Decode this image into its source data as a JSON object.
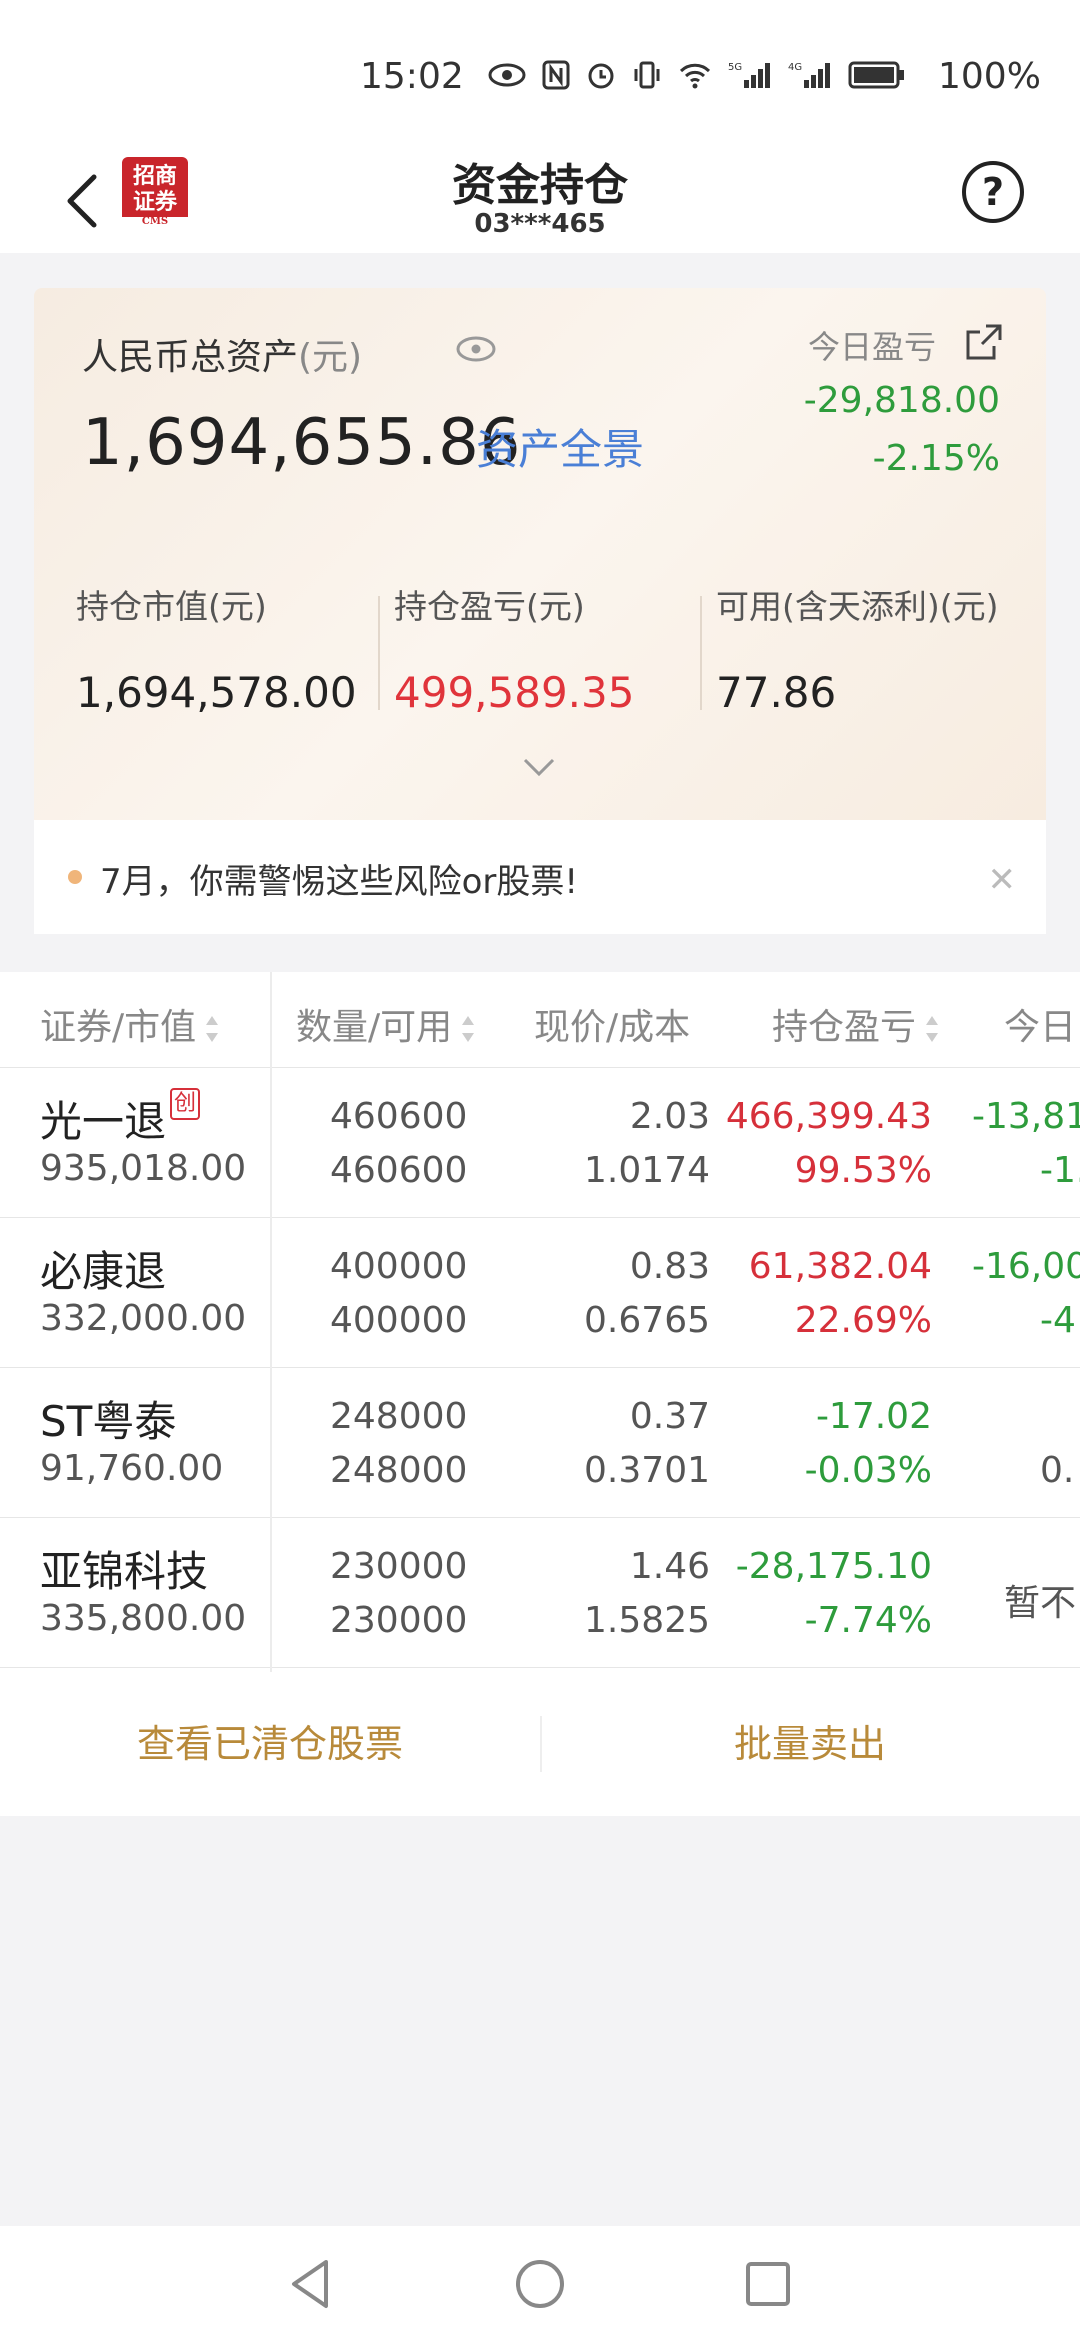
{
  "status_bar": {
    "time": "15:02",
    "battery": "100%",
    "icons": [
      "eye-icon",
      "nfc-icon",
      "alarm-icon",
      "vibrate-icon",
      "wifi-icon",
      "5g-signal-icon",
      "4g-signal-icon",
      "battery-icon"
    ]
  },
  "header": {
    "title": "资金持仓",
    "account": "03***465",
    "logo_text": "招商证券",
    "logo_sub": "CMS"
  },
  "assets": {
    "total_label": "人民币总资产",
    "total_unit": "(元)",
    "total_value": "1,694,655.86",
    "panorama_link": "资产全景",
    "today_label": "今日盈亏",
    "today_value": "-29,818.00",
    "today_pct": "-2.15%",
    "metrics": [
      {
        "label": "持仓市值(元)",
        "value": "1,694,578.00"
      },
      {
        "label": "持仓盈亏(元)",
        "value": "499,589.35"
      },
      {
        "label": "可用(含天添利)(元)",
        "value": "77.86"
      }
    ]
  },
  "notice": {
    "text": "7月，你需警惕这些风险or股票!"
  },
  "table": {
    "headers": [
      "证券/市值",
      "数量/可用",
      "现价/成本",
      "持仓盈亏",
      "今日"
    ],
    "rows": [
      {
        "name": "光一退",
        "badge": "创",
        "market_value": "935,018.00",
        "qty": "460600",
        "avail": "460600",
        "price": "2.03",
        "cost": "1.0174",
        "pl": "466,399.43",
        "pl_pct": "99.53%",
        "pl_dir": "up",
        "today": "-13,81",
        "today_pct": "-1.",
        "today_dir": "down"
      },
      {
        "name": "必康退",
        "badge": "",
        "market_value": "332,000.00",
        "qty": "400000",
        "avail": "400000",
        "price": "0.83",
        "cost": "0.6765",
        "pl": "61,382.04",
        "pl_pct": "22.69%",
        "pl_dir": "up",
        "today": "-16,00",
        "today_pct": "-4",
        "today_dir": "down"
      },
      {
        "name": "ST粤泰",
        "badge": "",
        "market_value": "91,760.00",
        "qty": "248000",
        "avail": "248000",
        "price": "0.37",
        "cost": "0.3701",
        "pl": "-17.02",
        "pl_pct": "-0.03%",
        "pl_dir": "down",
        "today": "",
        "today_pct": "0.",
        "today_dir": "neutral"
      },
      {
        "name": "亚锦科技",
        "badge": "",
        "market_value": "335,800.00",
        "qty": "230000",
        "avail": "230000",
        "price": "1.46",
        "cost": "1.5825",
        "pl": "-28,175.10",
        "pl_pct": "-7.74%",
        "pl_dir": "down",
        "today": "暂不",
        "today_pct": "",
        "today_dir": "neutral"
      }
    ]
  },
  "actions": {
    "view_cleared": "查看已清仓股票",
    "batch_sell": "批量卖出"
  },
  "colors": {
    "up": "#d6303a",
    "down": "#2e9c3c",
    "accent": "#b88a3a",
    "link": "#4a7fd6"
  }
}
